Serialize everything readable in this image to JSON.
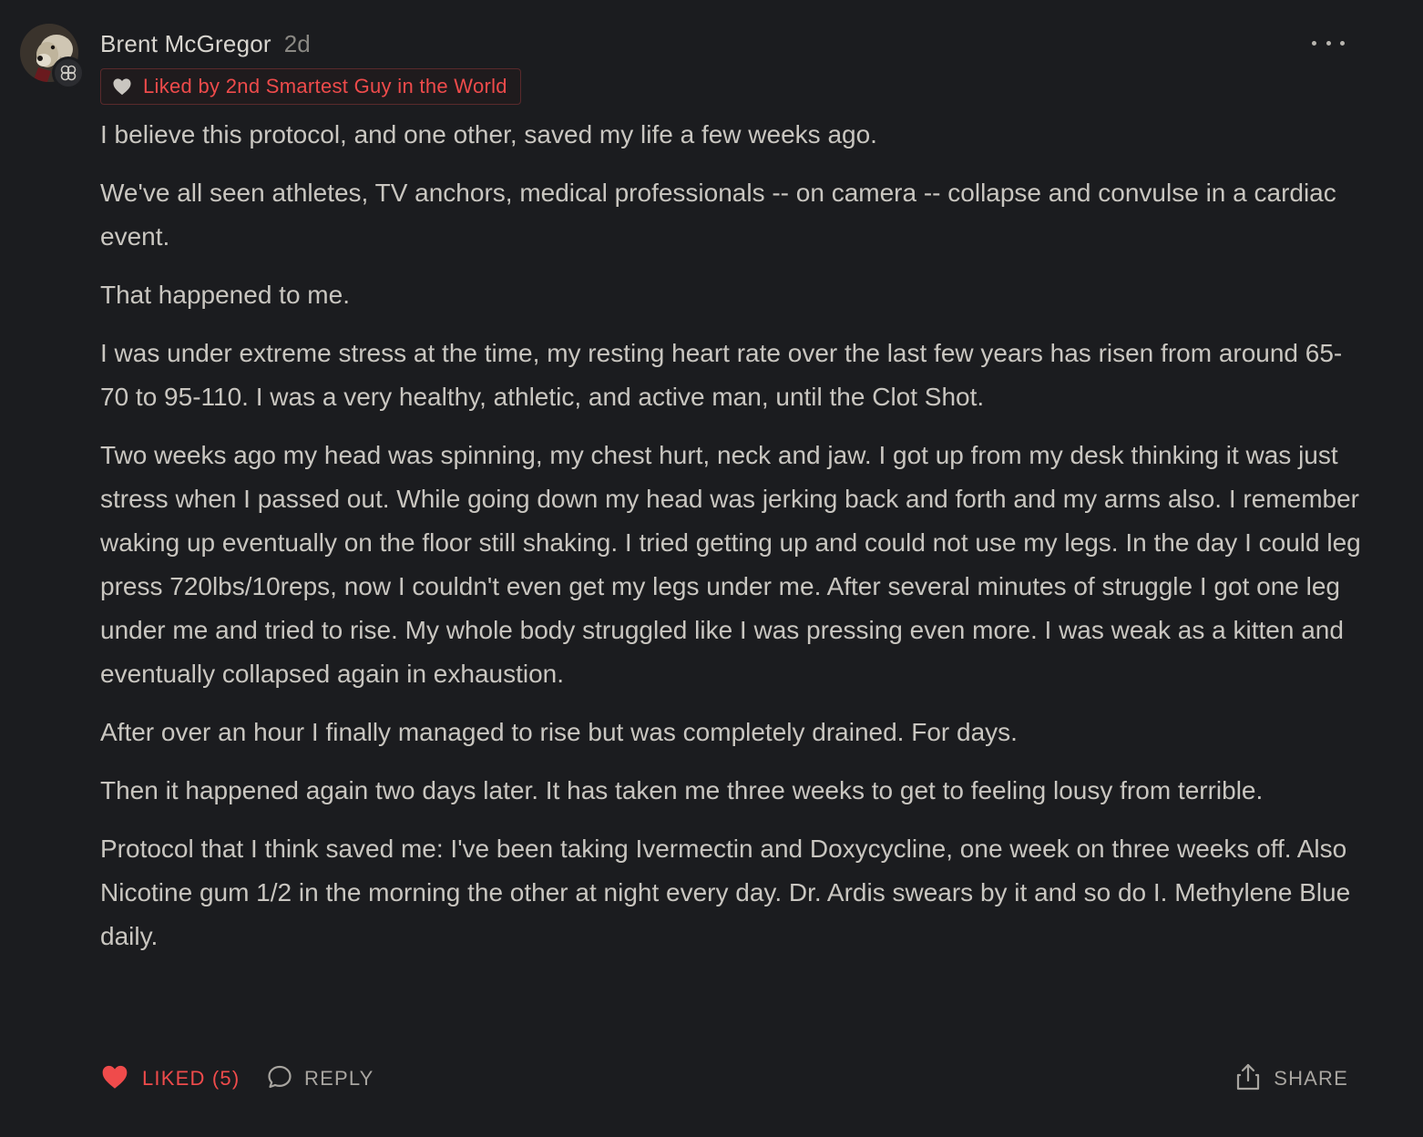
{
  "comment": {
    "author": "Brent McGregor",
    "timestamp": "2d",
    "liked_by": "Liked by 2nd Smartest Guy in the World",
    "paragraphs": [
      "I believe this protocol, and one other, saved my life a few weeks ago.",
      "We've all seen athletes, TV anchors, medical professionals -- on camera -- collapse and convulse in a cardiac event.",
      "That happened to me.",
      "I was under extreme stress at the time, my resting heart rate over the last few years has risen from around 65-70 to 95-110. I was a very healthy, athletic, and active man, until the Clot Shot.",
      "Two weeks ago my head was spinning, my chest hurt, neck and jaw. I got up from my desk thinking it was just stress when I passed out. While going down my head was jerking back and forth and my arms also. I remember waking up eventually on the floor still shaking. I tried getting up and could not use my legs. In the day I could leg press 720lbs/10reps, now I couldn't even get my legs under me. After several minutes of struggle I got one leg under me and tried to rise. My whole body struggled like I was pressing even more. I was weak as a kitten and eventually collapsed again in exhaustion.",
      "After over an hour I finally managed to rise but was completely drained. For days.",
      "Then it happened again two days later. It has taken me three weeks to get to feeling lousy from terrible.",
      "Protocol that I think saved me: I've been taking Ivermectin and Doxycycline, one week on three weeks off. Also Nicotine gum 1/2 in the morning the other at night every day. Dr. Ardis swears by it and so do I. Methylene Blue daily."
    ]
  },
  "actions": {
    "like_label": "LIKED (5)",
    "reply_label": "REPLY",
    "share_label": "SHARE"
  },
  "icons": {
    "more": "more-horizontal-icon",
    "heart": "heart-icon",
    "reply": "speech-bubble-icon",
    "share": "share-upload-icon",
    "badge": "flower-badge-icon"
  },
  "colors": {
    "background": "#1b1c1f",
    "text": "#c9c6c0",
    "author": "#d8d5cf",
    "muted": "#8a8883",
    "accent_red": "#ef4b4b"
  }
}
